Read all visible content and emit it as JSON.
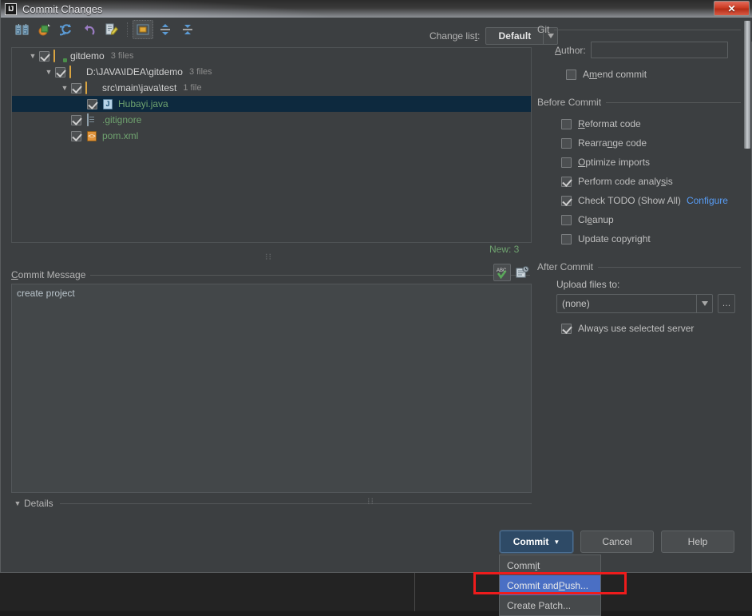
{
  "window": {
    "title": "Commit Changes",
    "app_icon": "IJ",
    "close_label": "✕"
  },
  "toolbar": {
    "buttons": [
      {
        "name": "show-diff-icon",
        "label": ""
      },
      {
        "name": "revert-changes-icon",
        "label": ""
      },
      {
        "name": "refresh-icon",
        "label": ""
      },
      {
        "name": "rollback-icon",
        "label": ""
      },
      {
        "name": "edit-source-icon",
        "label": ""
      },
      {
        "name": "group-by-directory-icon",
        "label": ""
      },
      {
        "name": "expand-all-icon",
        "label": ""
      },
      {
        "name": "collapse-all-icon",
        "label": ""
      }
    ]
  },
  "changelist": {
    "label": "Change list:",
    "label_prefix": "Change lis",
    "label_mnemonic": "t",
    "label_suffix": ":",
    "value": "Default",
    "arrow": "▼"
  },
  "tree": {
    "rows": [
      {
        "twisty": "▼",
        "indent": 0,
        "checked": true,
        "icon": "folder-git-icon",
        "label": "gitdemo",
        "count": "3 files",
        "status": "mod"
      },
      {
        "twisty": "▼",
        "indent": 1,
        "checked": true,
        "icon": "folder-icon",
        "label": "D:\\JAVA\\IDEA\\gitdemo",
        "count": "3 files",
        "status": "mod"
      },
      {
        "twisty": "▼",
        "indent": 2,
        "checked": true,
        "icon": "folder-icon",
        "label": "src\\main\\java\\test",
        "count": "1 file",
        "status": "mod"
      },
      {
        "twisty": "",
        "indent": 3,
        "checked": true,
        "icon": "java-file-icon",
        "label": "Hubayi.java",
        "count": "",
        "status": "new",
        "selected": true
      },
      {
        "twisty": "",
        "indent": 2,
        "checked": true,
        "icon": "text-file-icon",
        "label": ".gitignore",
        "count": "",
        "status": "new"
      },
      {
        "twisty": "",
        "indent": 2,
        "checked": true,
        "icon": "xml-file-icon",
        "label": "pom.xml",
        "count": "",
        "status": "new"
      }
    ],
    "new_count_text": "New: 3"
  },
  "commit_message": {
    "label": "Commit Message",
    "label_mnemonic": "C",
    "label_rest": "ommit Message",
    "value": "create project",
    "spellcheck_icon": "spellcheck-icon",
    "history_icon": "message-history-icon"
  },
  "details": {
    "twisty": "▼",
    "label": "Details"
  },
  "git_group": {
    "title": "Git",
    "author_label": "Author:",
    "author_mnemonic": "A",
    "author_label_rest": "uthor:",
    "author_value": "",
    "amend_label": "Amend commit",
    "amend_prefix": "A",
    "amend_mnemonic": "m",
    "amend_rest": "end commit",
    "amend_checked": false
  },
  "before_commit": {
    "title": "Before Commit",
    "options": [
      {
        "label": "Reformat code",
        "prefix": "",
        "mnemonic": "R",
        "rest": "eformat code",
        "checked": false
      },
      {
        "label": "Rearrange code",
        "prefix": "Rearra",
        "mnemonic": "n",
        "rest": "ge code",
        "checked": false
      },
      {
        "label": "Optimize imports",
        "prefix": "",
        "mnemonic": "O",
        "rest": "ptimize imports",
        "checked": false
      },
      {
        "label": "Perform code analysis",
        "prefix": "Perform code analy",
        "mnemonic": "s",
        "rest": "is",
        "checked": true
      },
      {
        "label": "Check TODO (Show All)",
        "prefix": "Check TODO (Show All)",
        "mnemonic": "",
        "rest": "",
        "checked": true,
        "link": "Configure"
      },
      {
        "label": "Cleanup",
        "prefix": "Cl",
        "mnemonic": "e",
        "rest": "anup",
        "checked": false
      },
      {
        "label": "Update copyright",
        "prefix": "Update copyright",
        "mnemonic": "",
        "rest": "",
        "checked": false
      }
    ]
  },
  "after_commit": {
    "title": "After Commit",
    "upload_label": "Upload files to:",
    "upload_value": "(none)",
    "upload_arrow": "▼",
    "browse_label": "…",
    "always_label": "Always use selected server",
    "always_checked": true
  },
  "buttons": {
    "commit": "Commit",
    "commit_arrow": "▼",
    "cancel": "Cancel",
    "help": "Help"
  },
  "commit_menu": {
    "items": [
      {
        "label": "Commit",
        "prefix": "Comm",
        "mnemonic": "i",
        "rest": "t",
        "highlighted": false
      },
      {
        "label": "Commit and Push...",
        "prefix": "Commit and ",
        "mnemonic": "P",
        "rest": "ush...",
        "highlighted": true
      },
      {
        "label": "Create Patch...",
        "prefix": "Create Patch...",
        "mnemonic": "",
        "rest": "",
        "highlighted": false
      }
    ],
    "highlight_color": "#ee1c1c"
  }
}
